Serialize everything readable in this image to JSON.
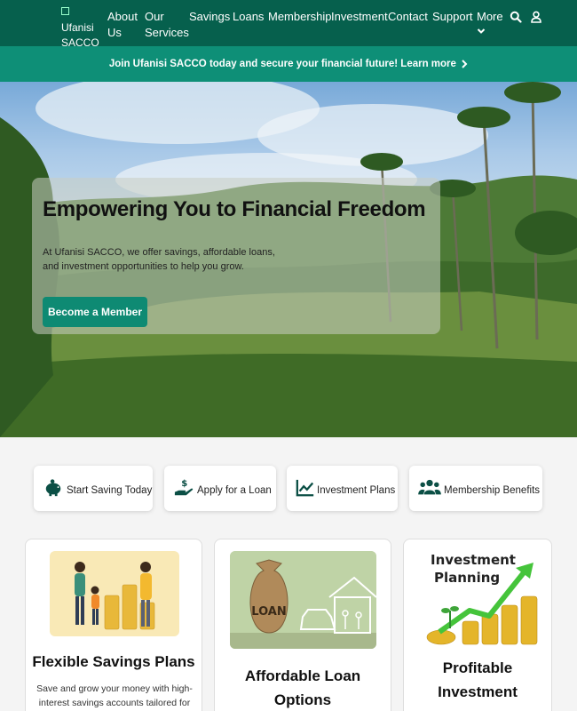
{
  "header": {
    "logo_alt": "Ufanisi SACCO",
    "nav": [
      {
        "label_line1": "About",
        "label_line2": "Us"
      },
      {
        "label_line1": "Our",
        "label_line2": "Services"
      },
      {
        "label": "Savings"
      },
      {
        "label": "Loans"
      },
      {
        "label": "Membership"
      },
      {
        "label": "Investment"
      },
      {
        "label": "Contact"
      },
      {
        "label": "Support"
      },
      {
        "label": "More"
      }
    ],
    "icons": [
      "search-icon",
      "user-icon",
      "chevron-down-icon"
    ]
  },
  "banner": {
    "text": "Join Ufanisi SACCO today and secure your financial future! Learn more"
  },
  "hero": {
    "title": "Empowering You to Financial Freedom",
    "description": "At Ufanisi SACCO, we offer savings, affordable loans, and investment opportunities to help you grow.",
    "cta": "Become a Member"
  },
  "quick_actions": [
    {
      "label": "Start Saving Today",
      "icon": "piggy-bank-icon"
    },
    {
      "label": "Apply for a Loan",
      "icon": "hand-holding-dollar-icon"
    },
    {
      "label": "Investment Plans",
      "icon": "chart-line-icon"
    },
    {
      "label": "Membership Benefits",
      "icon": "users-icon"
    }
  ],
  "cards": [
    {
      "title": "Flexible Savings Plans",
      "text": "Save and grow your money with high-interest savings accounts tailored for you."
    },
    {
      "title_line1": "Affordable Loan",
      "title_line2": "Options"
    },
    {
      "title_line1": "Profitable",
      "title_line2": "Investment"
    }
  ],
  "card_images": {
    "investment_text_line1": "Investment",
    "investment_text_line2": "Planning",
    "loan_bag_text": "LOAN"
  },
  "colors": {
    "nav_bg": "#06604d",
    "banner_bg": "#0e8f77",
    "button_bg": "#0e8a73"
  }
}
